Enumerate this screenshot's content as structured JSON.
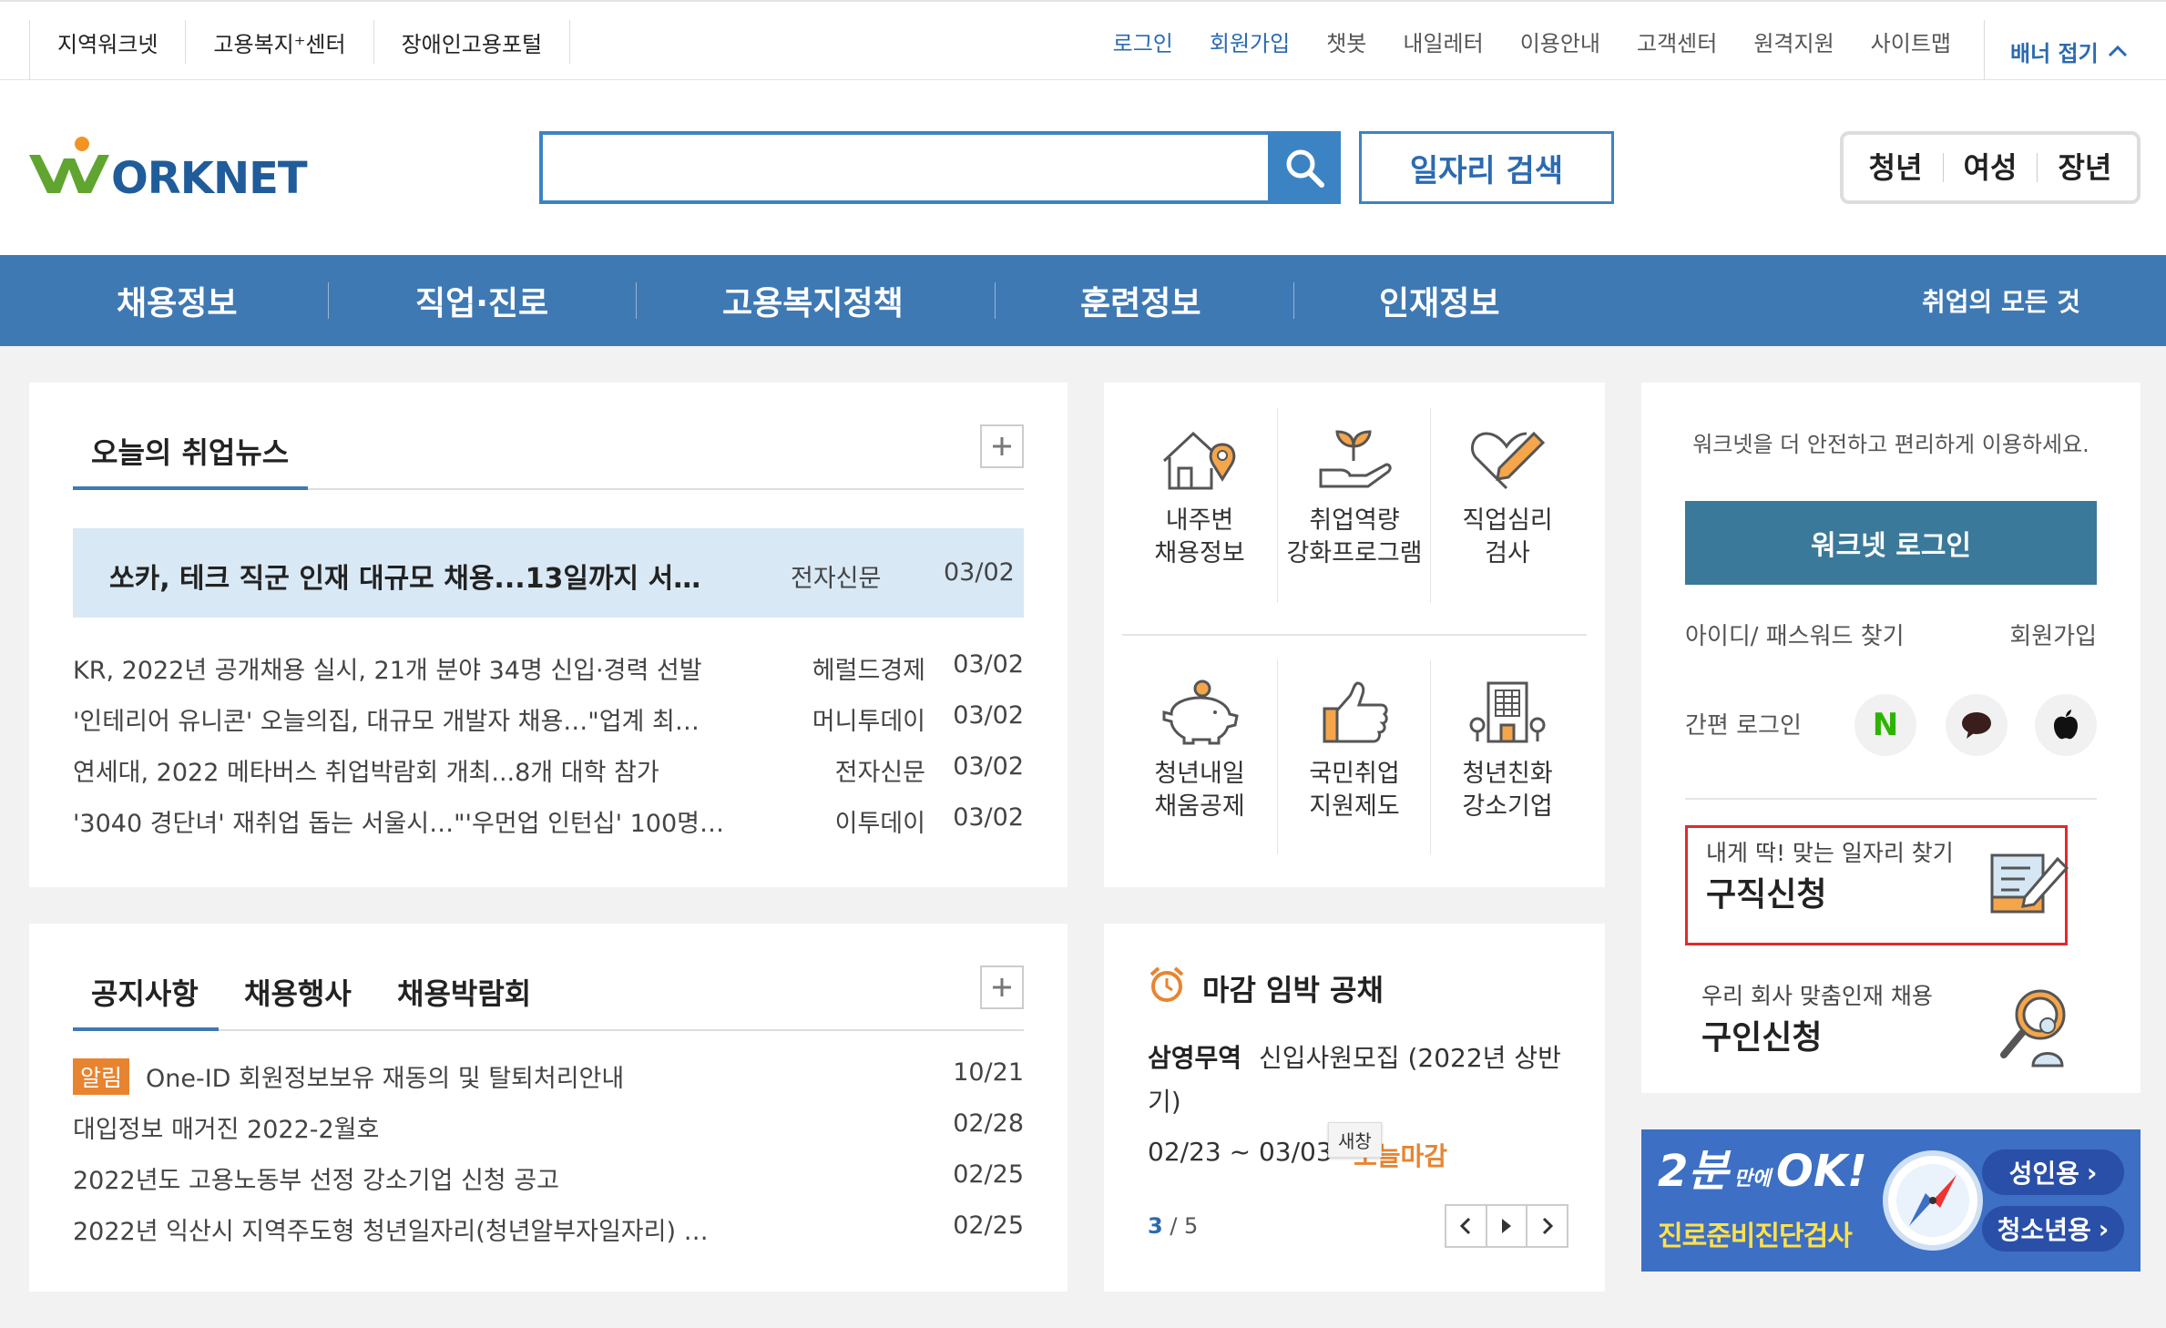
{
  "topbar": {
    "sites": [
      "지역워크넷",
      "고용복지⁺센터",
      "장애인고용포털"
    ],
    "links": [
      {
        "label": "로그인",
        "blue": true
      },
      {
        "label": "회원가입",
        "blue": true
      },
      {
        "label": "챗봇",
        "blue": false
      },
      {
        "label": "내일레터",
        "blue": false
      },
      {
        "label": "이용안내",
        "blue": false
      },
      {
        "label": "고객센터",
        "blue": false
      },
      {
        "label": "원격지원",
        "blue": false
      },
      {
        "label": "사이트맵",
        "blue": false
      }
    ],
    "fold_label": "배너 접기"
  },
  "header": {
    "logo_text": "ORKNET",
    "search_placeholder": "",
    "job_search_label": "일자리 검색",
    "age_tabs": [
      "청년",
      "여성",
      "장년"
    ]
  },
  "gnb": {
    "items": [
      "채용정보",
      "직업·진로",
      "고용복지정책",
      "훈련정보",
      "인재정보"
    ],
    "all_label": "취업의 모든 것"
  },
  "news": {
    "title": "오늘의 취업뉴스",
    "featured": {
      "title": "쏘카, 테크 직군 인재 대규모 채용...13일까지 서…",
      "source": "전자신문",
      "date": "03/02"
    },
    "items": [
      {
        "title": "KR, 2022년 공개채용 실시, 21개 분야 34명 신입·경력 선발",
        "source": "헤럴드경제",
        "date": "03/02"
      },
      {
        "title": "'인테리어 유니콘' 오늘의집, 대규모 개발자 채용…\"업계 최…",
        "source": "머니투데이",
        "date": "03/02"
      },
      {
        "title": "연세대, 2022 메타버스 취업박람회 개최...8개 대학 참가",
        "source": "전자신문",
        "date": "03/02"
      },
      {
        "title": "'3040 경단녀' 재취업 돕는 서울시…\"'우먼업 인턴십' 100명…",
        "source": "이투데이",
        "date": "03/02"
      }
    ]
  },
  "notice": {
    "tabs": [
      "공지사항",
      "채용행사",
      "채용박람회"
    ],
    "badge": "알림",
    "items": [
      {
        "title": "One-ID 회원정보보유 재동의 및 탈퇴처리안내",
        "date": "10/21"
      },
      {
        "title": "대입정보 매거진 2022-2월호",
        "date": "02/28"
      },
      {
        "title": "2022년도 고용노동부 선정 강소기업 신청 공고",
        "date": "02/25"
      },
      {
        "title": "2022년 익산시 지역주도형 청년일자리(청년알부자일자리) …",
        "date": "02/25"
      }
    ]
  },
  "services": [
    {
      "line1": "내주변",
      "line2": "채용정보",
      "icon": "house-pin-icon"
    },
    {
      "line1": "취업역량",
      "line2": "강화프로그램",
      "icon": "plant-hand-icon"
    },
    {
      "line1": "직업심리",
      "line2": "검사",
      "icon": "heart-pencil-icon"
    },
    {
      "line1": "청년내일",
      "line2": "채움공제",
      "icon": "piggy-bank-icon"
    },
    {
      "line1": "국민취업",
      "line2": "지원제도",
      "icon": "thumbs-up-icon"
    },
    {
      "line1": "청년친화",
      "line2": "강소기업",
      "icon": "building-icon"
    }
  ],
  "deadline": {
    "title": "마감 임박 공채",
    "company": "삼영무역",
    "job_line1": "신입사원모집 (2022년 상반",
    "job_line2": "기)",
    "period": "02/23 ~ 03/03",
    "tooltip": "새창",
    "status": "오늘마감",
    "page_current": "3",
    "page_total": "/ 5"
  },
  "login": {
    "message": "워크넷을 더 안전하고 편리하게 이용하세요.",
    "button": "워크넷 로그인",
    "find": "아이디/ 패스워드 찾기",
    "join": "회원가입",
    "easy_login": "간편 로그인",
    "naver": "N"
  },
  "apply": {
    "job_sub": "내게 딱! 맞는 일자리 찾기",
    "job_title": "구직신청",
    "hire_sub": "우리 회사 맞춤인재 채용",
    "hire_title": "구인신청"
  },
  "banner": {
    "headline1": "2분",
    "headline_small": "만에",
    "headline2": "OK!",
    "sub": "진로준비진단검사",
    "btn_adult": "성인용",
    "btn_youth": "청소년용"
  },
  "colors": {
    "brand_blue": "#3f79b4",
    "link_blue": "#2b6ab1",
    "highlight": "#d9e8f5",
    "orange": "#e88430",
    "login_btn": "#3b799a",
    "red_box": "#e02a2a",
    "logo_green": "#5fa530"
  }
}
